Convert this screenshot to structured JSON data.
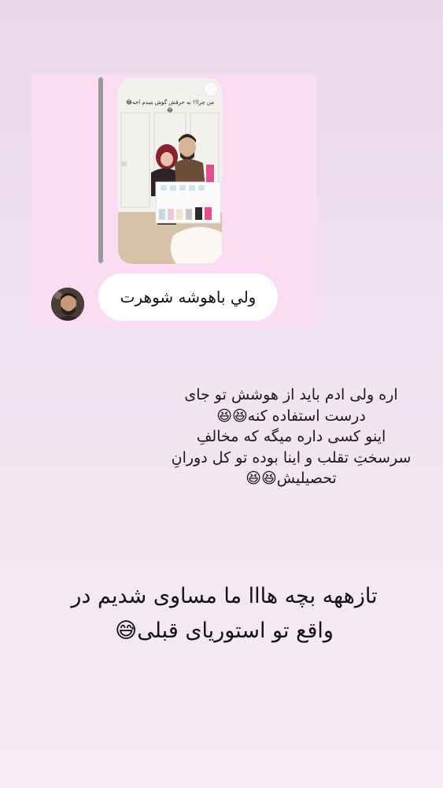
{
  "shared_story": {
    "caption": "من چرا!! به حرفش گوش میدم اخه😂😂",
    "reply_text": "ولي باهوشه شوهرت"
  },
  "comment": {
    "lines": [
      "اره ولی ادم باید از هوشش تو جای",
      "درست استفاده کنه😆😆",
      "اینو کسی داره میگه که مخالفِ",
      "سرسختِ تقلب و اینا بوده تو کل دورانِ",
      "تحصیلیش😆😆"
    ]
  },
  "headline": {
    "lines": [
      "تازههه بچه هااا ما مساوی شدیم در",
      "واقع تو استوریای قبلی😅"
    ]
  },
  "colors": {
    "background_top": "#ead9e9",
    "background_bottom": "#f6ecf4",
    "card_pink": "#fbdcf2",
    "bubble": "#ffffff"
  }
}
